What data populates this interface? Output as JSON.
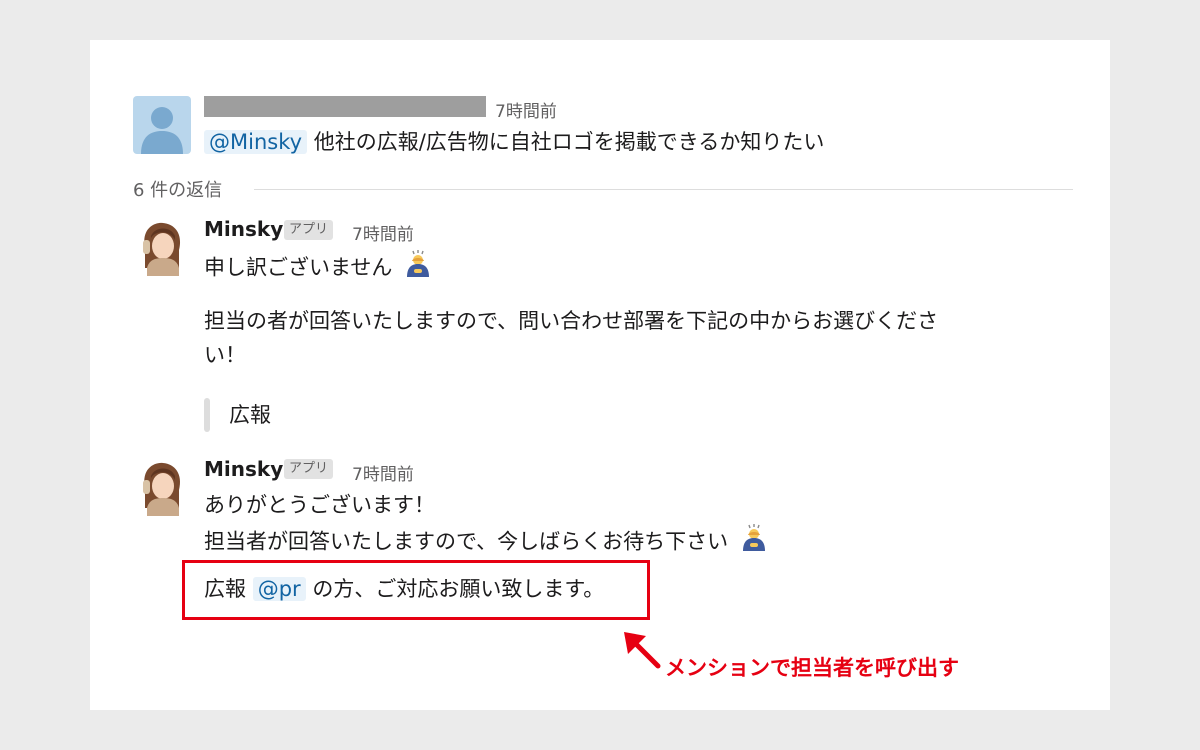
{
  "thread": {
    "parent": {
      "timestamp": "7時間前",
      "mention": "@Minsky",
      "text": "他社の広報/広告物に自社ロゴを掲載できるか知りたい"
    },
    "replies_label": "6 件の返信",
    "replies": [
      {
        "name": "Minsky",
        "badge": "アプリ",
        "timestamp": "7時間前",
        "line1": "申し訳ございません",
        "line2": "担当の者が回答いたしますので、問い合わせ部署を下記の中からお選びくださ",
        "line3": "い！",
        "quote": "広報"
      },
      {
        "name": "Minsky",
        "badge": "アプリ",
        "timestamp": "7時間前",
        "line1": "ありがとうございます！",
        "line2": "担当者が回答いたしますので、今しばらくお待ち下さい",
        "line3_prefix": "広報",
        "line3_mention": "@pr",
        "line3_suffix": "の方、ご対応お願い致します。"
      }
    ]
  },
  "annotation": {
    "text": "メンションで担当者を呼び出す",
    "color": "#e60012"
  },
  "icons": [
    "user-avatar-icon",
    "bowing-person-emoji-icon",
    "arrow-icon"
  ]
}
